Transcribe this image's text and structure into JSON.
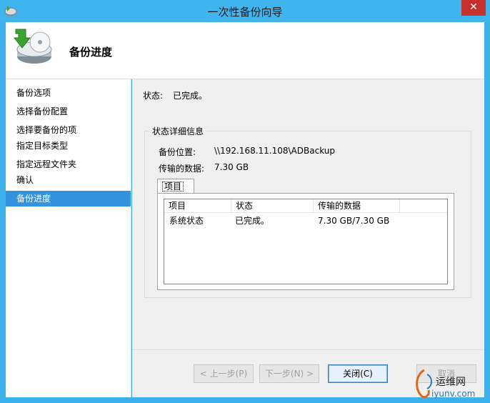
{
  "window": {
    "title": "一次性备份向导",
    "close_symbol": "✕"
  },
  "header": {
    "title": "备份进度"
  },
  "sidebar": {
    "items": [
      {
        "label": "备份选项"
      },
      {
        "label": "选择备份配置"
      },
      {
        "label": "选择要备份的项"
      },
      {
        "label": "指定目标类型"
      },
      {
        "label": "指定远程文件夹"
      },
      {
        "label": "确认"
      },
      {
        "label": "备份进度",
        "active": true
      }
    ]
  },
  "status": {
    "label": "状态:",
    "value": "已完成。"
  },
  "details": {
    "title": "状态详细信息",
    "location_label": "备份位置:",
    "location_value": "\\\\192.168.11.108\\ADBackup",
    "transferred_label": "传输的数据:",
    "transferred_value": "7.30 GB",
    "tab_label": "项目",
    "table": {
      "columns": [
        "项目",
        "状态",
        "传输的数据"
      ],
      "rows": [
        [
          "系统状态",
          "已完成。",
          "7.30 GB/7.30 GB"
        ]
      ]
    }
  },
  "buttons": {
    "prev": "< 上一步(P)",
    "next": "下一步(N) >",
    "close": "关闭(C)",
    "cancel": "取消"
  },
  "watermark": {
    "text": "运维网",
    "url": "iyunv.com"
  },
  "colors": {
    "titlebar": "#40b4ee",
    "selection": "#3393df",
    "close_button": "#c7312b"
  }
}
